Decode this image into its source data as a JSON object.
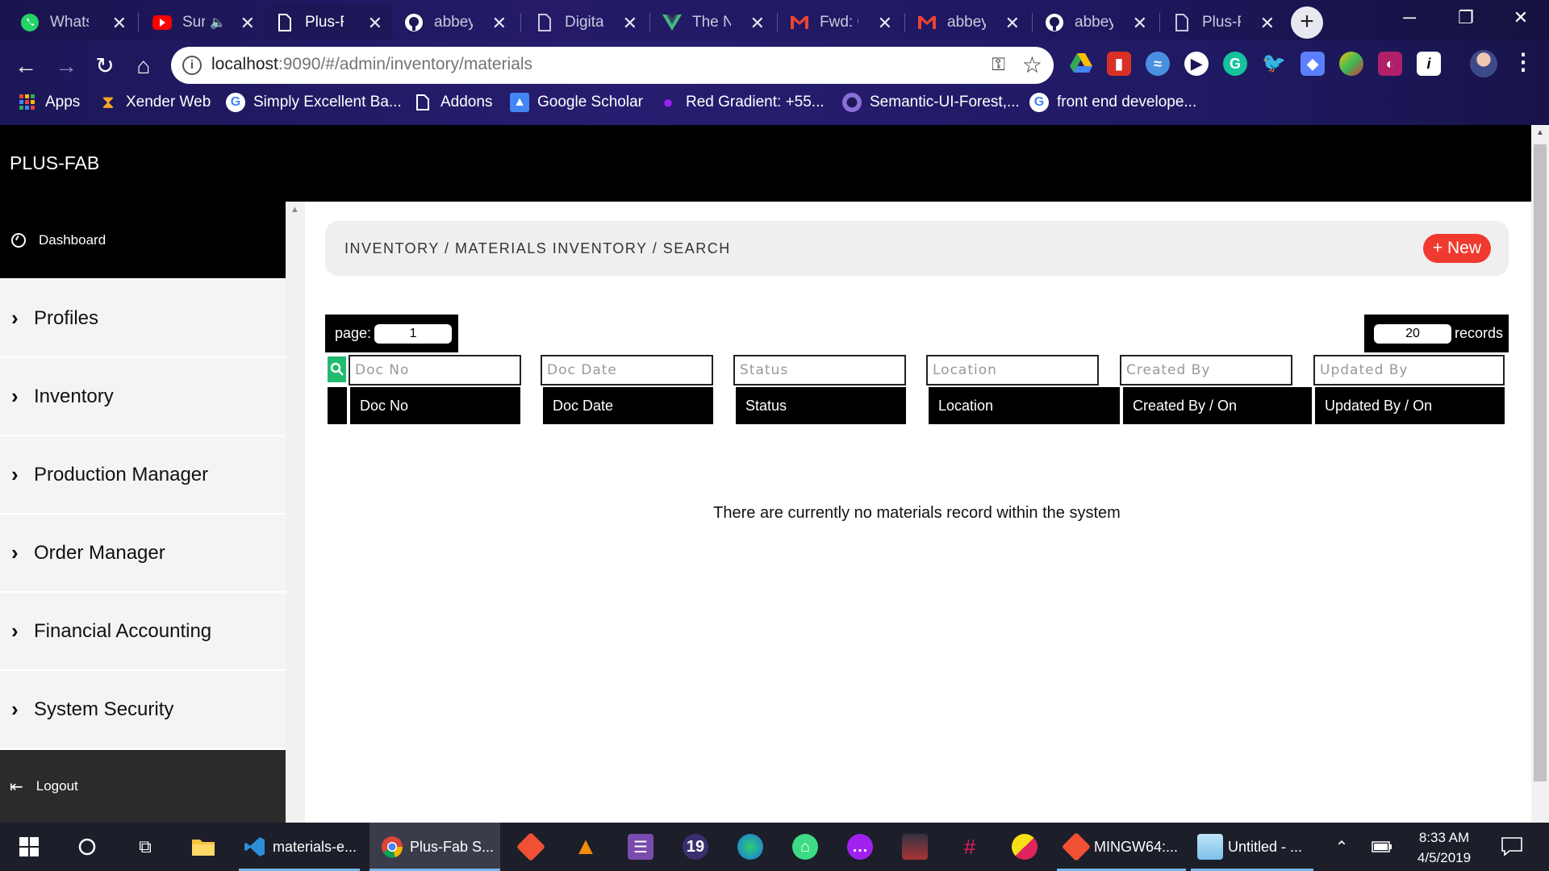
{
  "browser": {
    "tabs": [
      {
        "title": "WhatsApp",
        "icon": "whatsapp-icon",
        "color": "#25d366"
      },
      {
        "title": "Surfing",
        "icon": "youtube-icon",
        "color": "#ff0000"
      },
      {
        "title": "Plus-Fab",
        "icon": "page-icon",
        "color": "#ffffff",
        "active": true
      },
      {
        "title": "abbeyd",
        "icon": "github-icon",
        "color": "#ffffff"
      },
      {
        "title": "Digital",
        "icon": "page-icon",
        "color": "#c9c8de"
      },
      {
        "title": "The Net",
        "icon": "vue-icon",
        "color": "#41b883"
      },
      {
        "title": "Fwd: Ou",
        "icon": "gmail-icon",
        "color": "#ea4335"
      },
      {
        "title": "abbeyd",
        "icon": "gmail-icon",
        "color": "#ea4335"
      },
      {
        "title": "abbeyd",
        "icon": "github-icon",
        "color": "#ffffff"
      },
      {
        "title": "Plus-Fab",
        "icon": "page-icon",
        "color": "#c9c8de"
      }
    ],
    "url_host": "localhost",
    "url_rest": ":9090/#/admin/inventory/materials",
    "bookmarks": [
      {
        "label": "Apps",
        "icon": "apps-grid-icon",
        "color": "#ea4335"
      },
      {
        "label": "Xender Web",
        "icon": "xender-icon",
        "color": "#f5a623"
      },
      {
        "label": "Simply Excellent Ba...",
        "icon": "google-icon",
        "color": "#ffffff"
      },
      {
        "label": "Addons",
        "icon": "page-icon",
        "color": "#ffffff"
      },
      {
        "label": "Google Scholar",
        "icon": "scholar-icon",
        "color": "#4285f4"
      },
      {
        "label": "Red Gradient: +55...",
        "icon": "drop-icon",
        "color": "#a020f0"
      },
      {
        "label": "Semantic-UI-Forest,...",
        "icon": "semantic-icon",
        "color": "#6a4fbf"
      },
      {
        "label": "front end develope...",
        "icon": "google-icon",
        "color": "#ffffff"
      }
    ]
  },
  "app": {
    "brand": "PLUS-FAB",
    "sidebar": {
      "dashboard": "Dashboard",
      "items": [
        "Profiles",
        "Inventory",
        "Production Manager",
        "Order Manager",
        "Financial Accounting",
        "System Security"
      ],
      "logout": "Logout"
    },
    "breadcrumb": "INVENTORY / MATERIALS INVENTORY / SEARCH",
    "new_button": "+ New",
    "pager": {
      "page_label": "page:",
      "page_value": "1",
      "records_value": "20",
      "records_label": "records"
    },
    "filters": [
      "Doc No",
      "Doc Date",
      "Status",
      "Location",
      "Created By",
      "Updated By"
    ],
    "columns": [
      "Doc No",
      "Doc Date",
      "Status",
      "Location",
      "Created By / On",
      "Updated By / On"
    ],
    "empty_message": "There are currently no materials record within the system",
    "colors": {
      "accent_red": "#f03a2f",
      "search_green": "#21ba6f",
      "header_black": "#000000"
    }
  },
  "taskbar": {
    "apps": [
      {
        "label": "materials-e...",
        "icon": "vscode-icon"
      },
      {
        "label": "Plus-Fab S...",
        "icon": "chrome-icon"
      },
      {
        "label": "MINGW64:...",
        "icon": "git-icon"
      },
      {
        "label": "Untitled - ...",
        "icon": "notepad-icon"
      }
    ],
    "time": "8:33 AM",
    "date": "4/5/2019"
  }
}
